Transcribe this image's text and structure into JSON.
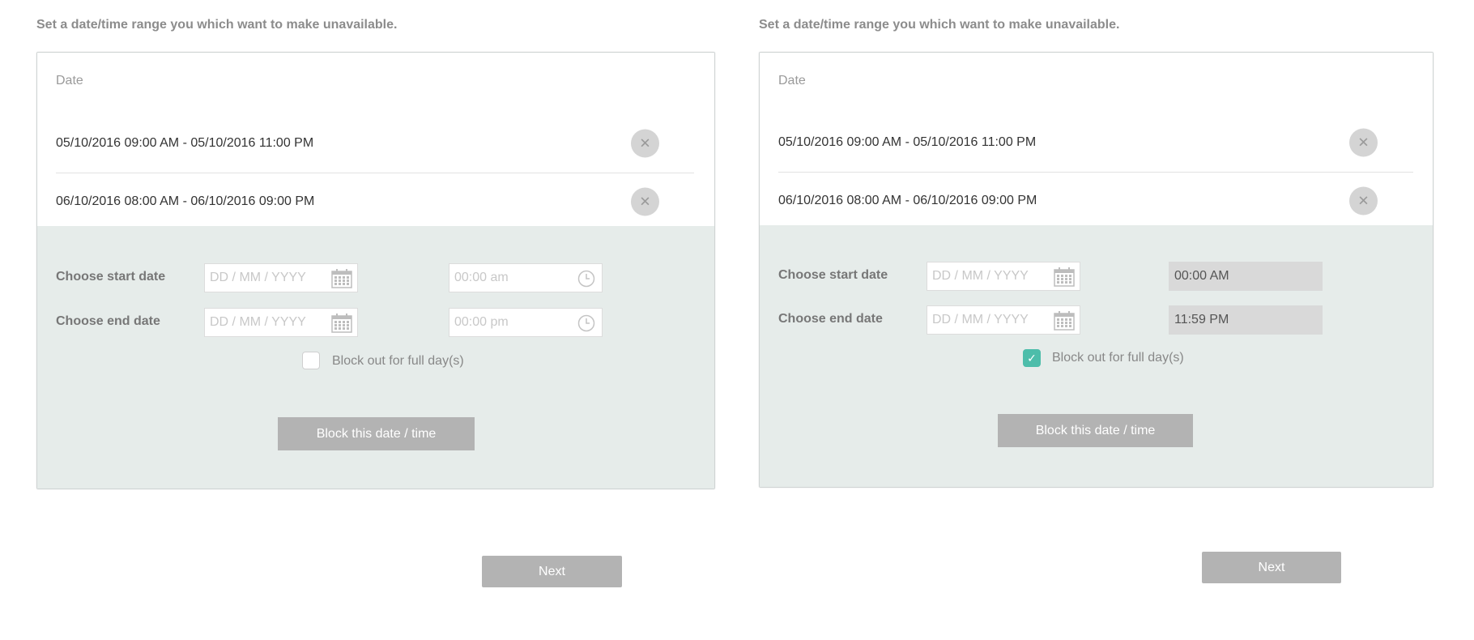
{
  "panels": [
    {
      "instruction": "Set a date/time range you which want to make unavailable.",
      "list_header": "Date",
      "ranges": [
        {
          "text": "05/10/2016 09:00 AM - 05/10/2016 11:00 PM"
        },
        {
          "text": "06/10/2016 08:00 AM - 06/10/2016 09:00 PM"
        }
      ],
      "remove_icon": "close-icon",
      "start_label": "Choose start date",
      "end_label": "Choose end date",
      "start_date_placeholder": "DD / MM / YYYY",
      "end_date_placeholder": "DD / MM / YYYY",
      "start_time": "00:00 am",
      "end_time": "00:00 pm",
      "time_state": "placeholder",
      "full_day_label": "Block out for full day(s)",
      "full_day_checked": false,
      "block_button": "Block this date / time",
      "next_button": "Next"
    },
    {
      "instruction": "Set a date/time range you which want to make unavailable.",
      "list_header": "Date",
      "ranges": [
        {
          "text": "05/10/2016 09:00 AM - 05/10/2016 11:00 PM"
        },
        {
          "text": "06/10/2016 08:00 AM - 06/10/2016 09:00 PM"
        }
      ],
      "remove_icon": "close-icon",
      "start_label": "Choose start date",
      "end_label": "Choose end date",
      "start_date_placeholder": "DD / MM / YYYY",
      "end_date_placeholder": "DD / MM / YYYY",
      "start_time": "00:00 AM",
      "end_time": "11:59 PM",
      "time_state": "disabled",
      "full_day_label": "Block out for full day(s)",
      "full_day_checked": true,
      "check_mark": "✓",
      "block_button": "Block this date / time",
      "next_button": "Next"
    }
  ],
  "colors": {
    "accent": "#4dbdaa",
    "form_bg": "#e6ecea",
    "button_bg": "#b3b3b3"
  }
}
